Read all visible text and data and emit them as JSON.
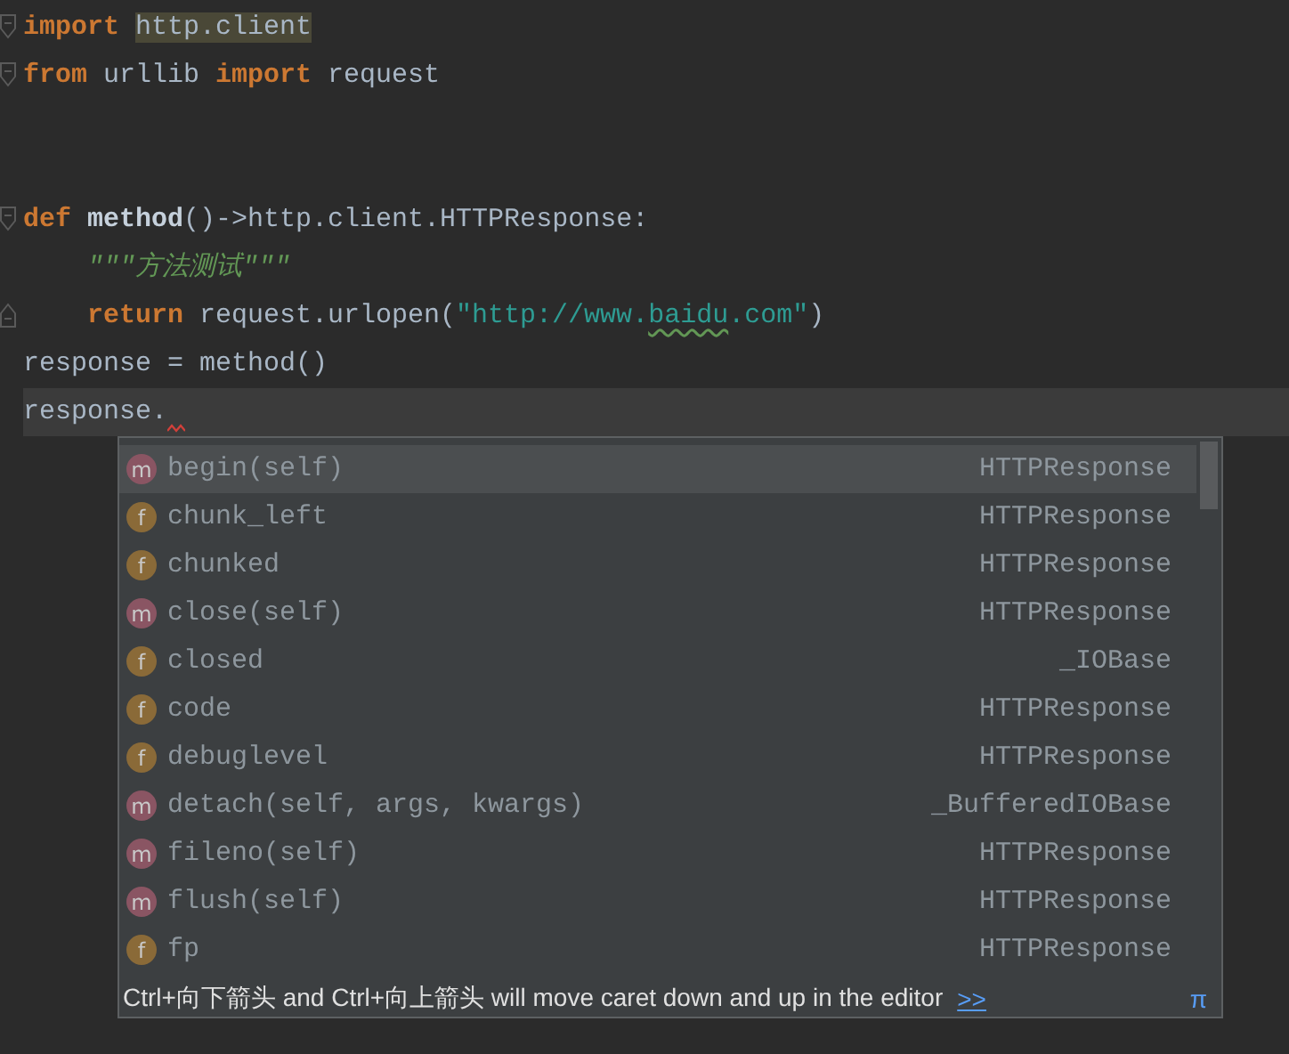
{
  "editor": {
    "lines": [
      {
        "gap_before": false,
        "fold_start": true,
        "fold_end": false,
        "indented": false,
        "current": false,
        "error_mark": false,
        "tokens": [
          {
            "text": "import ",
            "kind": "keyword"
          },
          {
            "text": "http.client",
            "kind": "usage_highlight"
          }
        ]
      },
      {
        "gap_before": false,
        "fold_start": true,
        "fold_end": false,
        "indented": false,
        "current": false,
        "error_mark": false,
        "tokens": [
          {
            "text": "from",
            "kind": "keyword"
          },
          {
            "text": " urllib ",
            "kind": "text"
          },
          {
            "text": "import",
            "kind": "keyword"
          },
          {
            "text": " request",
            "kind": "text"
          }
        ]
      },
      {
        "gap_before": true,
        "fold_start": true,
        "fold_end": false,
        "indented": false,
        "current": false,
        "error_mark": false,
        "tokens": [
          {
            "text": "def ",
            "kind": "keyword"
          },
          {
            "text": "method",
            "kind": "func_def"
          },
          {
            "text": "()->http.client.HTTPResponse:",
            "kind": "text"
          }
        ]
      },
      {
        "gap_before": false,
        "fold_start": false,
        "fold_end": false,
        "indented": true,
        "current": false,
        "error_mark": false,
        "tokens": [
          {
            "text": "\"\"\"方法测试\"\"\"",
            "kind": "doc"
          }
        ]
      },
      {
        "gap_before": false,
        "fold_start": false,
        "fold_end": true,
        "indented": true,
        "current": false,
        "error_mark": false,
        "tokens": [
          {
            "text": "return",
            "kind": "keyword"
          },
          {
            "text": " request.urlopen(",
            "kind": "text"
          },
          {
            "text": "\"http://www.",
            "kind": "string"
          },
          {
            "text": "baidu",
            "kind": "string_typo"
          },
          {
            "text": ".com\"",
            "kind": "string"
          },
          {
            "text": ")",
            "kind": "text"
          }
        ]
      },
      {
        "gap_before": false,
        "fold_start": false,
        "fold_end": false,
        "indented": false,
        "current": false,
        "error_mark": false,
        "tokens": [
          {
            "text": "response = method()",
            "kind": "text"
          }
        ]
      },
      {
        "gap_before": false,
        "fold_start": false,
        "fold_end": false,
        "indented": false,
        "current": true,
        "error_mark": true,
        "tokens": [
          {
            "text": "response.",
            "kind": "text"
          }
        ]
      }
    ]
  },
  "completion": {
    "items": [
      {
        "icon_letter": "m",
        "kind": "method",
        "name": "begin(self)",
        "type": "HTTPResponse",
        "selected": true
      },
      {
        "icon_letter": "f",
        "kind": "field",
        "name": "chunk_left",
        "type": "HTTPResponse",
        "selected": false
      },
      {
        "icon_letter": "f",
        "kind": "field",
        "name": "chunked",
        "type": "HTTPResponse",
        "selected": false
      },
      {
        "icon_letter": "m",
        "kind": "method",
        "name": "close(self)",
        "type": "HTTPResponse",
        "selected": false
      },
      {
        "icon_letter": "f",
        "kind": "field",
        "name": "closed",
        "type": "_IOBase",
        "selected": false
      },
      {
        "icon_letter": "f",
        "kind": "field",
        "name": "code",
        "type": "HTTPResponse",
        "selected": false
      },
      {
        "icon_letter": "f",
        "kind": "field",
        "name": "debuglevel",
        "type": "HTTPResponse",
        "selected": false
      },
      {
        "icon_letter": "m",
        "kind": "method",
        "name": "detach(self, args, kwargs)",
        "type": "_BufferedIOBase",
        "selected": false
      },
      {
        "icon_letter": "m",
        "kind": "method",
        "name": "fileno(self)",
        "type": "HTTPResponse",
        "selected": false
      },
      {
        "icon_letter": "m",
        "kind": "method",
        "name": "flush(self)",
        "type": "HTTPResponse",
        "selected": false
      },
      {
        "icon_letter": "f",
        "kind": "field",
        "name": "fp",
        "type": "HTTPResponse",
        "selected": false
      }
    ],
    "hint": {
      "text": "Ctrl+向下箭头 and Ctrl+向上箭头 will move caret down and up in the editor",
      "link": ">>",
      "symbol": "π"
    }
  }
}
